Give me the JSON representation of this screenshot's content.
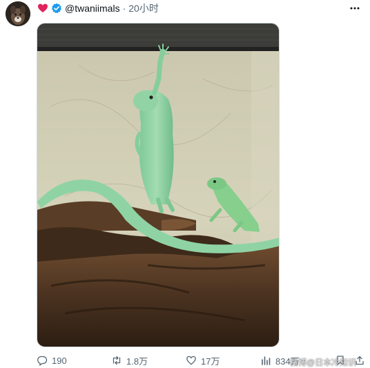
{
  "post": {
    "author_handle": "@twaniimals",
    "separator": "·",
    "time_ago": "20小时",
    "more_label": "•••"
  },
  "actions": {
    "replies": "190",
    "reposts": "1.8万",
    "likes": "17万",
    "views": "834万"
  },
  "watermark": {
    "text": "微博@日本冷知识"
  },
  "icons": {
    "badge": "heart-icon",
    "verified": "verified-check-icon",
    "reply": "speech-bubble-icon",
    "repost": "repost-arrows-icon",
    "like": "heart-outline-icon",
    "views": "bar-chart-icon",
    "bookmark": "bookmark-icon",
    "share": "share-upload-icon"
  },
  "colors": {
    "verified": "#1d9bf0",
    "heart": "#e0245e",
    "muted": "#536471"
  }
}
